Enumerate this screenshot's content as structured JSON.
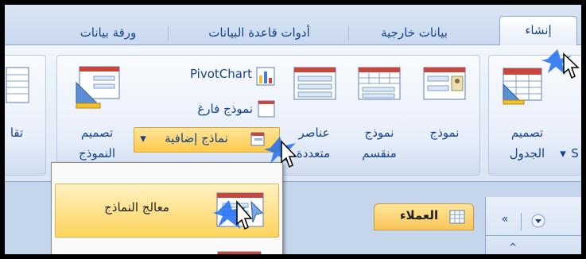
{
  "tabs": [
    {
      "label": "إنشاء",
      "active": true
    },
    {
      "label": "بيانات خارجية"
    },
    {
      "label": "أدوات قاعدة البيانات"
    },
    {
      "label": "ورقة بيانات"
    }
  ],
  "ribbon": {
    "table_design": {
      "line1": "تصميم",
      "line2": "الجدول"
    },
    "form": "نموذج",
    "split_form": {
      "line1": "نموذج",
      "line2": "منقسم"
    },
    "multiple_items": {
      "line1": "عناصر",
      "line2": "متعددة"
    },
    "pivot_chart": "PivotChart",
    "blank_form": "نموذج فارغ",
    "more_forms": "نماذج إضافية",
    "form_design": {
      "line1": "تصميم",
      "line2": "النموذج"
    },
    "cut_left": "تقا",
    "cut_right": "S"
  },
  "menu": {
    "form_wizard": "معالج النماذج"
  },
  "document": {
    "tab_label": "العملاء"
  },
  "colors": {
    "text": "#15428b",
    "highlight": "#ffd45c",
    "accent": "#2f6fd0"
  }
}
